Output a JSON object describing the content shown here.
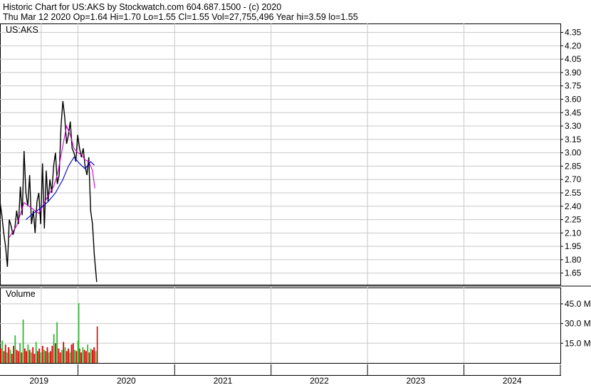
{
  "chart_data": {
    "type": "line",
    "header": {
      "title": "Historic Chart for US:AKS by Stockwatch.com 604.687.1500 - (c) 2020",
      "stats": "Thu Mar 12 2020  Op=1.64  Hi=1.70  Lo=1.55  Cl=1.55  Vol=27,755,496  Year hi=3.59  lo=1.55"
    },
    "price_panel": {
      "label": "US:AKS",
      "ylim": [
        1.52,
        4.45
      ],
      "yticks": [
        "4.35",
        "4.20",
        "4.05",
        "3.90",
        "3.75",
        "3.60",
        "3.45",
        "3.30",
        "3.15",
        "3.00",
        "2.85",
        "2.70",
        "2.55",
        "2.40",
        "2.25",
        "2.10",
        "1.95",
        "1.80",
        "1.65"
      ],
      "series": [
        {
          "role": "price",
          "color": "#000000",
          "x": [
            "2019-03-12",
            "2019-03-19",
            "2019-03-26",
            "2019-04-02",
            "2019-04-09",
            "2019-04-16",
            "2019-04-23",
            "2019-04-30",
            "2019-05-07",
            "2019-05-14",
            "2019-05-21",
            "2019-05-28",
            "2019-06-04",
            "2019-06-11",
            "2019-06-18",
            "2019-06-25",
            "2019-07-02",
            "2019-07-09",
            "2019-07-16",
            "2019-07-23",
            "2019-07-30",
            "2019-08-06",
            "2019-08-13",
            "2019-08-20",
            "2019-08-27",
            "2019-09-03",
            "2019-09-10",
            "2019-09-17",
            "2019-09-24",
            "2019-10-01",
            "2019-10-08",
            "2019-10-15",
            "2019-10-22",
            "2019-10-29",
            "2019-11-05",
            "2019-11-12",
            "2019-11-19",
            "2019-11-26",
            "2019-12-03",
            "2019-12-10",
            "2019-12-17",
            "2019-12-24",
            "2019-12-31",
            "2020-01-07",
            "2020-01-14",
            "2020-01-21",
            "2020-01-28",
            "2020-02-04",
            "2020-02-11",
            "2020-02-18",
            "2020-02-25",
            "2020-03-03",
            "2020-03-12"
          ],
          "y": [
            2.45,
            2.3,
            2.1,
            1.95,
            1.72,
            2.25,
            2.18,
            2.08,
            2.15,
            2.35,
            2.2,
            2.62,
            2.3,
            3.02,
            2.55,
            2.4,
            2.75,
            2.2,
            2.35,
            2.1,
            2.45,
            2.55,
            2.2,
            2.88,
            2.15,
            2.8,
            2.45,
            2.7,
            2.55,
            2.85,
            3.0,
            2.65,
            2.75,
            3.3,
            3.58,
            3.4,
            3.1,
            3.2,
            3.35,
            3.05,
            3.0,
            2.9,
            3.2,
            3.05,
            2.95,
            3.05,
            2.85,
            2.75,
            2.95,
            2.35,
            2.2,
            1.85,
            1.55
          ]
        },
        {
          "role": "short moving average",
          "color": "#cc00cc",
          "x": [
            "2019-04-16",
            "2019-05-14",
            "2019-06-11",
            "2019-07-09",
            "2019-08-06",
            "2019-09-03",
            "2019-10-01",
            "2019-10-15",
            "2019-11-05",
            "2019-11-19",
            "2019-12-03",
            "2019-12-17",
            "2019-12-31",
            "2020-01-14",
            "2020-01-28",
            "2020-02-11",
            "2020-02-25",
            "2020-03-05"
          ],
          "y": [
            2.05,
            2.18,
            2.44,
            2.38,
            2.32,
            2.48,
            2.62,
            2.75,
            3.08,
            3.3,
            3.2,
            3.05,
            3.0,
            2.98,
            2.92,
            2.9,
            2.8,
            2.6
          ]
        },
        {
          "role": "long moving average",
          "color": "#0000cc",
          "x": [
            "2019-06-18",
            "2019-07-16",
            "2019-08-13",
            "2019-09-10",
            "2019-10-08",
            "2019-11-05",
            "2019-11-26",
            "2019-12-17",
            "2020-01-07",
            "2020-01-28",
            "2020-02-18",
            "2020-03-03"
          ],
          "y": [
            2.25,
            2.32,
            2.38,
            2.45,
            2.55,
            2.7,
            2.85,
            2.95,
            2.88,
            2.82,
            2.9,
            2.86
          ]
        }
      ]
    },
    "volume_panel": {
      "label": "Volume",
      "ylim": [
        0,
        52
      ],
      "yticks": [
        "45.0 M",
        "30.0 M",
        "15.0 M"
      ],
      "bars_millions": [
        11,
        17,
        9,
        14,
        8,
        12,
        10,
        7,
        13,
        21,
        10,
        9,
        15,
        8,
        33,
        11,
        9,
        14,
        10,
        8,
        12,
        7,
        16,
        9,
        11,
        8,
        13,
        10,
        9,
        12,
        8,
        9,
        13,
        22,
        15,
        31,
        11,
        8,
        10,
        16,
        12,
        9,
        11,
        8,
        14,
        15,
        10,
        9,
        17,
        11,
        8,
        12,
        10,
        9,
        14,
        8,
        11,
        10,
        12,
        9
      ],
      "bar_colors": [
        "#dd0000",
        "#33bb33",
        "#dd0000",
        "#dd0000",
        "#33bb33",
        "#dd0000",
        "#33bb33",
        "#dd0000",
        "#dd0000",
        "#33bb33",
        "#dd0000",
        "#dd0000",
        "#33bb33",
        "#dd0000",
        "#33bb33",
        "#dd0000",
        "#dd0000",
        "#33bb33",
        "#dd0000",
        "#33bb33",
        "#dd0000",
        "#dd0000",
        "#33bb33",
        "#dd0000",
        "#dd0000",
        "#33bb33",
        "#dd0000",
        "#33bb33",
        "#dd0000",
        "#dd0000",
        "#33bb33",
        "#dd0000",
        "#dd0000",
        "#33bb33",
        "#dd0000",
        "#33bb33",
        "#dd0000",
        "#dd0000",
        "#33bb33",
        "#dd0000",
        "#33bb33",
        "#dd0000",
        "#dd0000",
        "#33bb33",
        "#dd0000",
        "#dd0000",
        "#33bb33",
        "#dd0000",
        "#33bb33",
        "#dd0000",
        "#dd0000",
        "#33bb33",
        "#dd0000",
        "#dd0000",
        "#33bb33",
        "#dd0000",
        "#33bb33",
        "#dd0000",
        "#dd0000",
        "#33bb33"
      ],
      "spikes": [
        {
          "date": "2020-01-02",
          "value_millions": 45.5,
          "color": "#33bb33"
        },
        {
          "date": "2020-03-12",
          "value_millions": 27.8,
          "color": "#dd0000"
        }
      ]
    },
    "x_axis": {
      "labels": [
        "2019",
        "2020",
        "2021",
        "2022",
        "2023",
        "2024"
      ],
      "range": [
        "2019-03-12",
        "2024-12-31"
      ]
    },
    "grid": true,
    "colors": {
      "grid": "#c8c8c8",
      "up": "#33bb33",
      "down": "#dd0000"
    }
  }
}
